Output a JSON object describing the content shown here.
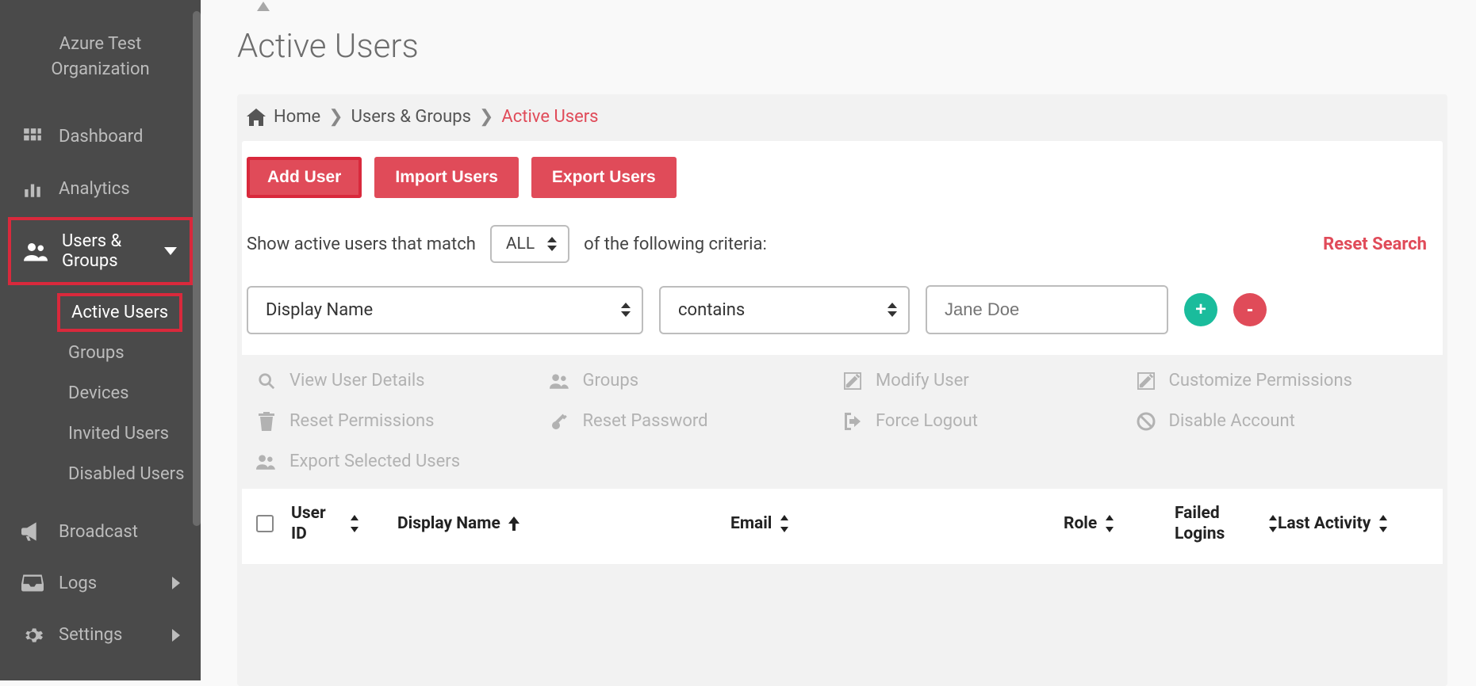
{
  "sidebar": {
    "org_name": "Azure Test Organization",
    "items": [
      {
        "label": "Dashboard"
      },
      {
        "label": "Analytics"
      },
      {
        "label": "Users & Groups",
        "expanded": true,
        "children": [
          {
            "label": "Active Users",
            "active": true
          },
          {
            "label": "Groups"
          },
          {
            "label": "Devices"
          },
          {
            "label": "Invited Users"
          },
          {
            "label": "Disabled Users"
          }
        ]
      },
      {
        "label": "Broadcast"
      },
      {
        "label": "Logs"
      },
      {
        "label": "Settings"
      }
    ]
  },
  "page": {
    "title": "Active Users",
    "breadcrumb": {
      "home": "Home",
      "mid": "Users & Groups",
      "current": "Active Users"
    },
    "buttons": {
      "add": "Add User",
      "import": "Import Users",
      "export": "Export Users"
    },
    "filter": {
      "prefix": "Show active users that match",
      "mode": "ALL",
      "suffix": "of the following criteria:",
      "reset": "Reset Search",
      "criteria": {
        "field": "Display Name",
        "op": "contains",
        "value_placeholder": "Jane Doe"
      }
    },
    "actions": [
      "View User Details",
      "Groups",
      "Modify User",
      "Customize Permissions",
      "Reset Permissions",
      "Reset Password",
      "Force Logout",
      "Disable Account",
      "Export Selected Users"
    ],
    "table": {
      "cols": [
        "User ID",
        "Display Name",
        "Email",
        "Role",
        "Failed Logins",
        "Last Activity"
      ]
    }
  }
}
